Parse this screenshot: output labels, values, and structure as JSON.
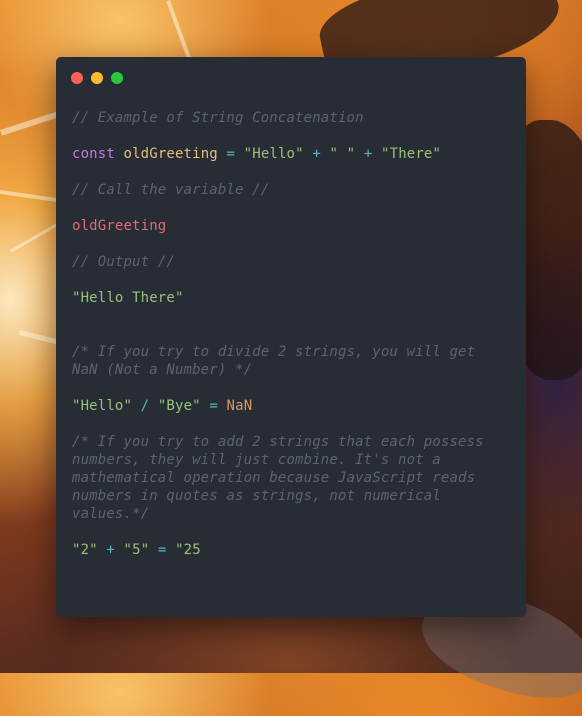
{
  "window": {
    "controls": [
      "close",
      "minimize",
      "maximize"
    ]
  },
  "code": {
    "comment_1": "// Example of String Concatenation",
    "line_const": {
      "keyword": "const",
      "name": "oldGreeting",
      "eq": "=",
      "str1": "\"Hello\"",
      "plus1": "+",
      "str2": "\" \"",
      "plus2": "+",
      "str3": "\"There\""
    },
    "comment_2": "// Call the variable //",
    "call": "oldGreeting",
    "comment_3": "// Output //",
    "output": "\"Hello There\"",
    "comment_4": "/* If you try to divide 2 strings, you will get NaN (Not a Number) */",
    "divide": {
      "str1": "\"Hello\"",
      "op": "/",
      "str2": "\"Bye\"",
      "eq": "=",
      "result": "NaN"
    },
    "comment_5": "/* If you try to add 2 strings that each possess numbers, they will just combine. It's not a mathematical operation because JavaScript reads numbers in quotes as strings, not numerical values.*/",
    "add": {
      "str1": "\"2\"",
      "plus": "+",
      "str2": "\"5\"",
      "eq": "=",
      "result": "\"25"
    }
  },
  "colors": {
    "window_bg": "#282c34",
    "comment": "#5c6370",
    "keyword": "#c678dd",
    "variable": "#e5c07b",
    "identifier": "#e06c75",
    "string": "#98c379",
    "operator": "#56b6c2",
    "number": "#d19a66"
  }
}
